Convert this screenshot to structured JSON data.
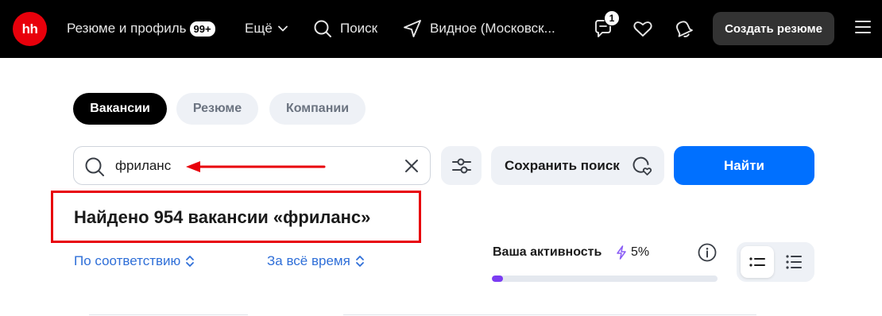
{
  "header": {
    "logo_text": "hh",
    "resume_profile_label": "Резюме и профиль",
    "resume_badge": "99+",
    "more_label": "Ещё",
    "search_label": "Поиск",
    "location_label": "Видное (Московск...",
    "chat_count": "1",
    "create_resume_label": "Создать резюме",
    "icons": [
      "chevron-down-icon",
      "search-icon",
      "location-arrow-icon",
      "chat-icon",
      "heart-icon",
      "bell-icon",
      "burger-menu-icon"
    ]
  },
  "tabs": [
    {
      "label": "Вакансии",
      "active": true
    },
    {
      "label": "Резюме",
      "active": false
    },
    {
      "label": "Компании",
      "active": false
    }
  ],
  "search": {
    "value": "фриланс",
    "save_search_label": "Сохранить поиск",
    "find_label": "Найти",
    "icons": [
      "search-icon",
      "clear-icon",
      "filter-sliders-icon",
      "saved-search-heart-icon"
    ]
  },
  "results": {
    "title": "Найдено 954 вакансии «фриланс»",
    "sort_relevance": "По соответствию",
    "sort_period": "За всё время"
  },
  "activity": {
    "label": "Ваша активность",
    "value": "5%",
    "progress_fraction": 0.05
  },
  "colors": {
    "header_bg": "#000000",
    "logo_red": "#e8000b",
    "primary_blue": "#0070ff",
    "link_blue": "#2f6fd8",
    "annotation_red": "#e8000b",
    "progress_purple": "#7b3cf2"
  }
}
